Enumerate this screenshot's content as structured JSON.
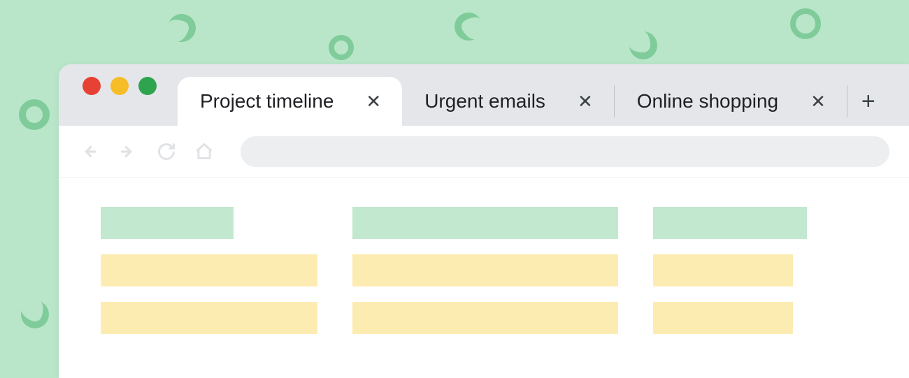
{
  "tabs": [
    {
      "label": "Project timeline",
      "active": true
    },
    {
      "label": "Urgent emails",
      "active": false
    },
    {
      "label": "Online shopping",
      "active": false
    }
  ],
  "traffic_lights": [
    "close",
    "minimize",
    "maximize"
  ],
  "colors": {
    "background": "#b9e6c9",
    "accent_green": "#c2e8cf",
    "accent_yellow": "#fdecb2",
    "tab_strip": "#e4e6e9"
  }
}
